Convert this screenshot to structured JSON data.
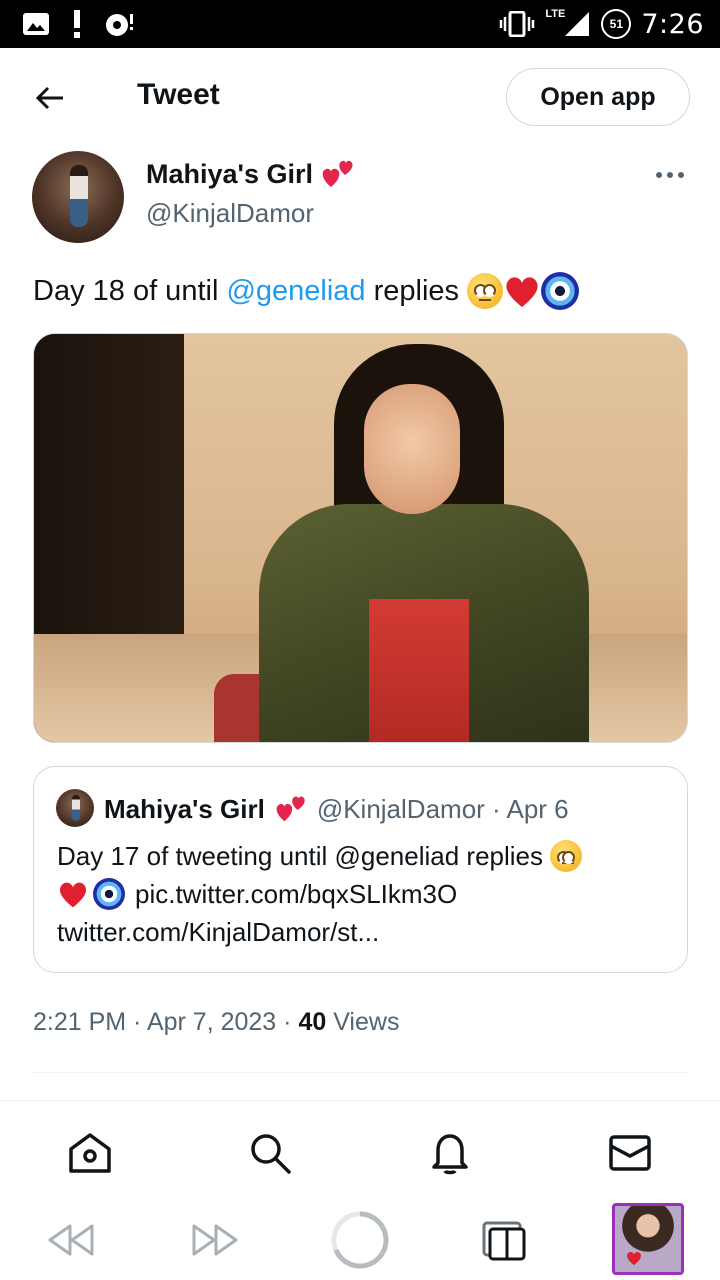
{
  "status_bar": {
    "network": "LTE",
    "battery": "51",
    "time": "7:26"
  },
  "header": {
    "title": "Tweet",
    "open_app_label": "Open app"
  },
  "tweet": {
    "author_name": "Mahiya's Girl",
    "author_handle": "@KinjalDamor",
    "text_before": "Day 18 of until",
    "mention": "@geneliad",
    "text_after": "replies",
    "timestamp": "2:21 PM · Apr 7, 2023 ·",
    "views_count": "40",
    "views_label": "Views"
  },
  "quote": {
    "author_name": "Mahiya's Girl",
    "meta": "@KinjalDamor · Apr 6",
    "line1": "Day 17 of tweeting until @geneliad replies",
    "line2": "pic.twitter.com/bqxSLIkm3O",
    "line3": "twitter.com/KinjalDamor/st..."
  },
  "colors": {
    "accent": "#1d9bf0",
    "text": "#0f1419",
    "muted": "#536471",
    "border": "#cfd9de",
    "tab_border": "#9b2fb8"
  },
  "icons": {
    "tab_nav": [
      "home-icon",
      "search-icon",
      "notifications-icon",
      "messages-icon"
    ],
    "browser_bar": [
      "rewind-icon",
      "fast-forward-icon",
      "loading-icon",
      "tabs-icon"
    ]
  }
}
